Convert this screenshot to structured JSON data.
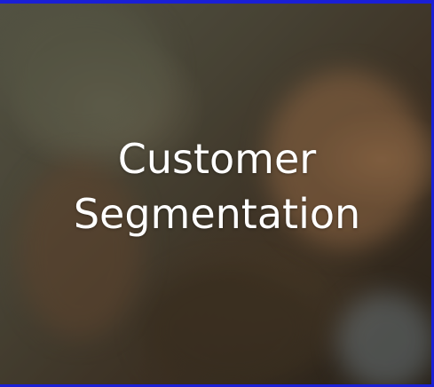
{
  "tile": {
    "title_line1": "Customer",
    "title_line2": "Segmentation"
  },
  "colors": {
    "border_accent": "#1a1fd6",
    "title_text": "#ffffff"
  }
}
